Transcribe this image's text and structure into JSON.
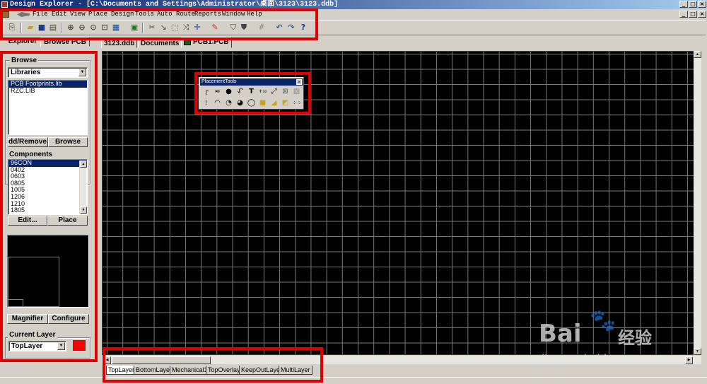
{
  "window": {
    "title": "Design Explorer - [C:\\Documents and Settings\\Administrator\\桌面\\3123\\3123.ddb]"
  },
  "menu": [
    "File",
    "Edit",
    "View",
    "Place",
    "Design",
    "Tools",
    "Auto Route",
    "Reports",
    "Window",
    "Help"
  ],
  "toolbar": {
    "icons": [
      "hierarchy-icon",
      "open-icon",
      "save-icon",
      "print-icon",
      "zoom-in-icon",
      "zoom-out-icon",
      "zoom-page-icon",
      "zoom-area-icon",
      "component-icon",
      "cross-probe-icon",
      "cut-icon",
      "paste-icon",
      "select-icon",
      "move-icon",
      "crosshair-icon",
      "highlight-icon",
      "library-icon",
      "grid-icon",
      "undo-icon",
      "redo-icon",
      "help-icon"
    ]
  },
  "left_panel": {
    "tabs": [
      "Explorer",
      "Browse PCB"
    ],
    "browse": {
      "title": "Browse",
      "selected": "Libraries",
      "libraries": [
        "PCB Footprints.lib",
        "RZC.LIB"
      ],
      "add_remove_label": "Add/Remove",
      "add_remove_visible": "dd/Remove",
      "browse_label": "Browse"
    },
    "components": {
      "title": "Components",
      "items": [
        "96CON",
        "0402",
        "0603",
        "0805",
        "1005",
        "1206",
        "1210",
        "1805"
      ],
      "edit_label": "Edit...",
      "place_label": "Place"
    },
    "magnifier_label": "Magnifier",
    "configure_label": "Configure",
    "current_layer": {
      "title": "Current Layer",
      "value": "TopLayer",
      "color": "#ff0000"
    }
  },
  "doc_tabs": [
    "3123.ddb",
    "Documents",
    "PCB1.PCB"
  ],
  "layer_tabs": [
    "TopLayer",
    "BottomLayer",
    "Mechanical1",
    "TopOverlay",
    "KeepOutLayer",
    "MultiLayer"
  ],
  "placement_tools": {
    "title": "PlacementTools",
    "row1": [
      "track-icon",
      "arc-wire-icon",
      "pad-icon",
      "via-icon",
      "text-icon",
      "coordinate-icon",
      "dimension-icon",
      "room-icon",
      "fill-icon"
    ],
    "row2": [
      "origin-icon",
      "arc-center-icon",
      "arc-edge-icon",
      "arc-any-icon",
      "circle-icon",
      "rect-fill-icon",
      "polygon-icon",
      "split-plane-icon",
      "array-icon"
    ]
  },
  "watermark": {
    "brand": "Bai",
    "brand2": "经验",
    "url": "jingyan.baidu.com"
  },
  "colors": {
    "highlight": "#e00000",
    "canvas": "#000000",
    "grid": "#7a7a7a",
    "selection": "#0a246a"
  }
}
